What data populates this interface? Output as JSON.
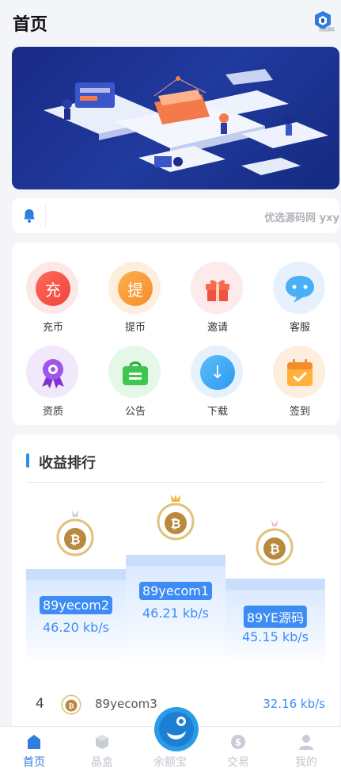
{
  "header": {
    "title": "首页",
    "logo_caption": "优选源码"
  },
  "notice": {
    "text": "优选源码网 yxy"
  },
  "menu": [
    {
      "label": "充币",
      "glyph": "充",
      "color": "#f3423b",
      "halo": "#fde8e8",
      "icon": "recharge-icon"
    },
    {
      "label": "提币",
      "glyph": "提",
      "color": "#f59a34",
      "halo": "#fdeedd",
      "icon": "withdraw-icon"
    },
    {
      "label": "邀请",
      "glyph": "",
      "color": "#f0523f",
      "halo": "#fdeaea",
      "icon": "gift-icon"
    },
    {
      "label": "客服",
      "glyph": "",
      "color": "#3b9cf3",
      "halo": "#e6f1fd",
      "icon": "chat-icon"
    },
    {
      "label": "资质",
      "glyph": "",
      "color": "#9b4ee2",
      "halo": "#f1e8fc",
      "icon": "award-icon"
    },
    {
      "label": "公告",
      "glyph": "",
      "color": "#36c24a",
      "halo": "#e5f8e7",
      "icon": "bag-icon"
    },
    {
      "label": "下载",
      "glyph": "↓",
      "color": "#3aa6f5",
      "halo": "#e5f2fd",
      "icon": "download-icon"
    },
    {
      "label": "签到",
      "glyph": "",
      "color": "#f59a34",
      "halo": "#fdeedd",
      "icon": "calendar-check-icon"
    }
  ],
  "ranking": {
    "title": "收益排行",
    "first": {
      "name": "89yecom1",
      "speed": "46.21 kb/s"
    },
    "second": {
      "name": "89yecom2",
      "speed": "46.20 kb/s"
    },
    "third": {
      "name": "89YE源码",
      "speed": "45.15 kb/s"
    },
    "row4": {
      "rank": "4",
      "name": "89yecom3",
      "speed": "32.16 kb/s"
    }
  },
  "tabs": [
    {
      "label": "首页",
      "active": true
    },
    {
      "label": "晶盒",
      "active": false
    },
    {
      "label": "余额宝",
      "active": false
    },
    {
      "label": "交易",
      "active": false
    },
    {
      "label": "我的",
      "active": false
    }
  ],
  "colors": {
    "accent": "#2f7de1",
    "rank_blue": "#3d8cf5"
  }
}
